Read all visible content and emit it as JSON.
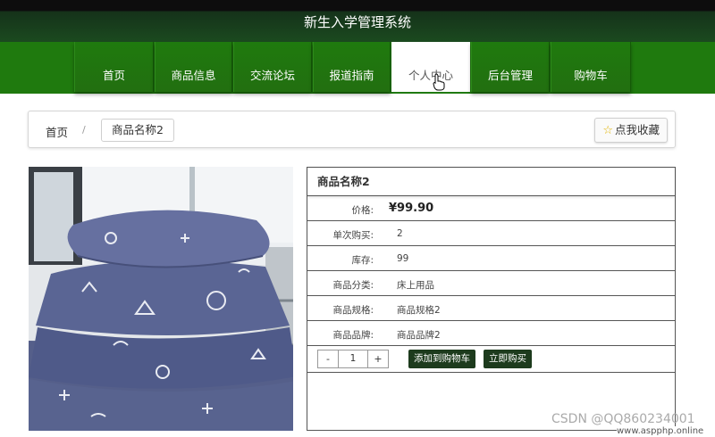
{
  "header": {
    "title": "新生入学管理系统"
  },
  "nav": {
    "items": [
      {
        "label": "首页"
      },
      {
        "label": "商品信息"
      },
      {
        "label": "交流论坛"
      },
      {
        "label": "报道指南"
      },
      {
        "label": "个人中心"
      },
      {
        "label": "后台管理"
      },
      {
        "label": "购物车"
      }
    ],
    "active_index": 4
  },
  "breadcrumb": {
    "home": "首页",
    "separator": "/",
    "current": "商品名称2"
  },
  "favorite": {
    "label": "点我收藏",
    "icon": "star-icon"
  },
  "product": {
    "title": "商品名称2",
    "price_label": "价格:",
    "price": "¥99.90",
    "single_buy_label": "单次购买:",
    "single_buy_value": "2",
    "stock_label": "库存:",
    "stock_value": "99",
    "category_label": "商品分类:",
    "category_value": "床上用品",
    "spec_label": "商品规格:",
    "spec_value": "商品规格2",
    "brand_label": "商品品牌:",
    "brand_value": "商品品牌2"
  },
  "purchase": {
    "minus_label": "-",
    "quantity": "1",
    "plus_label": "+",
    "add_to_cart_label": "添加到购物车",
    "buy_now_label": "立即购买"
  },
  "watermark": {
    "text": "CSDN @QQ860234001",
    "site": "www.aspphp.online"
  },
  "colors": {
    "nav_green": "#1f7a0e",
    "header_dark": "#1b4a1f",
    "button_dark": "#1d3b1d"
  }
}
